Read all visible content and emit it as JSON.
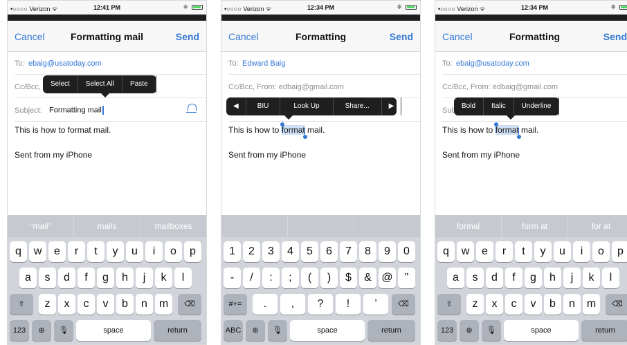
{
  "phones": [
    {
      "status": {
        "carrier": "•○○○○ Verizon ᯤ",
        "time": "12:41 PM"
      },
      "nav": {
        "cancel": "Cancel",
        "title": "Formatting mail",
        "send": "Send"
      },
      "to_label": "To:",
      "to_value": "ebaig@usatoday.com",
      "cc_label": "Cc/Bcc,",
      "subject_label": "Subject:",
      "subject_value": "Formatting mail",
      "body_line1": "This is how to format mail.",
      "body_line2": "Sent from my iPhone",
      "menu": [
        "Select",
        "Select All",
        "Paste"
      ],
      "predictions": [
        "“mail”",
        "mails",
        "mailboxes"
      ],
      "keys_row1": [
        "q",
        "w",
        "e",
        "r",
        "t",
        "y",
        "u",
        "i",
        "o",
        "p"
      ],
      "keys_row2": [
        "a",
        "s",
        "d",
        "f",
        "g",
        "h",
        "j",
        "k",
        "l"
      ],
      "keys_row3": [
        "z",
        "x",
        "c",
        "v",
        "b",
        "n",
        "m"
      ],
      "key_123": "123",
      "key_space": "space",
      "key_return": "return"
    },
    {
      "status": {
        "carrier": "•○○○○ Verizon ᯤ",
        "time": "12:34 PM"
      },
      "nav": {
        "cancel": "Cancel",
        "title": "Formatting",
        "send": "Send"
      },
      "to_label": "To:",
      "to_value": "Edward Baig",
      "cc_value": "Cc/Bcc, From: edbaig@gmail.com",
      "body_before": "This is how to ",
      "body_selected": "format",
      "body_after": " mail.",
      "body_line2": "Sent from my iPhone",
      "menu": [
        "◀",
        "BIU",
        "Look Up",
        "Share...",
        "▶"
      ],
      "keys_row1": [
        "1",
        "2",
        "3",
        "4",
        "5",
        "6",
        "7",
        "8",
        "9",
        "0"
      ],
      "keys_row2": [
        "-",
        "/",
        ":",
        ";",
        "(",
        ")",
        "$",
        "&",
        "@",
        "”"
      ],
      "keys_row3": [
        ".",
        ",",
        "?",
        "!",
        "’"
      ],
      "key_sym": "#+=",
      "key_abc": "ABC",
      "key_space": "space",
      "key_return": "return"
    },
    {
      "status": {
        "carrier": "•○○○○ Verizon ᯤ",
        "time": "12:34 PM"
      },
      "nav": {
        "cancel": "Cancel",
        "title": "Formatting",
        "send": "Send"
      },
      "to_label": "To:",
      "to_value": "ebaig@usatoday.com",
      "cc_value": "Cc/Bcc, From: edbaig@gmail.com",
      "subject_partial": "Sub",
      "body_before": "This is how to ",
      "body_selected": "format",
      "body_after": " mail.",
      "body_line2": "Sent from my iPhone",
      "menu": [
        "Bold",
        "Italic",
        "Underline"
      ],
      "predictions": [
        "formal",
        "form at",
        "for at"
      ],
      "keys_row1": [
        "q",
        "w",
        "e",
        "r",
        "t",
        "y",
        "u",
        "i",
        "o",
        "p"
      ],
      "keys_row2": [
        "a",
        "s",
        "d",
        "f",
        "g",
        "h",
        "j",
        "k",
        "l"
      ],
      "keys_row3": [
        "z",
        "x",
        "c",
        "v",
        "b",
        "n",
        "m"
      ],
      "key_123": "123",
      "key_space": "space",
      "key_return": "return"
    }
  ],
  "colors": {
    "accent": "#3478d5",
    "popup": "#1f1f1f",
    "keyboard": "#d1d4da"
  },
  "icons": [
    "wifi-icon",
    "bluetooth-icon",
    "battery-icon",
    "bell-icon",
    "shift-icon",
    "backspace-icon",
    "globe-icon",
    "mic-icon"
  ]
}
